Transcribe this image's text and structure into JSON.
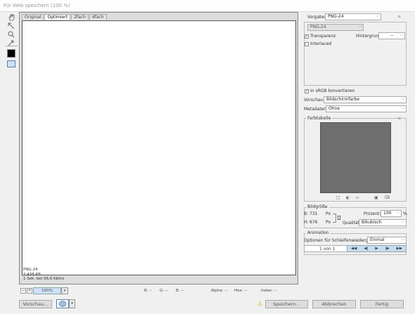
{
  "window": {
    "title": "Für Web speichern (100 %)"
  },
  "tools": [
    {
      "icon": "hand-icon"
    },
    {
      "icon": "slice-select-icon"
    },
    {
      "icon": "zoom-icon"
    },
    {
      "icon": "eyedropper-icon"
    }
  ],
  "tabs": [
    "Original",
    "Optimiert",
    "2fach",
    "4fach"
  ],
  "active_tab": "Optimiert",
  "canvas_info": {
    "format": "PNG-24",
    "size": "2,438 KB",
    "time": "1 Sek. bei 56,6 Kbit/s"
  },
  "status": {
    "zoom": "100%",
    "r": "R: --",
    "g": "G: --",
    "b": "B: --",
    "alpha": "Alpha: --",
    "hex": "Hex: --",
    "index": "Index: --"
  },
  "buttons": {
    "preview": "Vorschau...",
    "save": "Speichern...",
    "cancel": "Abbrechen",
    "done": "Fertig"
  },
  "panel": {
    "preset_label": "Vorgabe:",
    "preset_value": "PNG-24",
    "format_value": "PNG-24",
    "transparency": "Transparenz",
    "matte_label": "Hintergrund:",
    "matte_value": "--",
    "interlaced": "Interlaced",
    "srgb": "In sRGB konvertieren",
    "preview_label": "Vorschau:",
    "preview_value": "Bildschirmfarbe",
    "metadata_label": "Metadaten:",
    "metadata_value": "Ohne",
    "color_table": "Farbtabelle",
    "image_size": "Bildgröße",
    "width_label": "B:",
    "width_value": "731",
    "height_label": "H:",
    "height_value": "676",
    "px": "Px",
    "percent_label": "Prozent:",
    "percent_value": "100",
    "percent_unit": "%",
    "quality_label": "Qualität:",
    "quality_value": "Bikubisch",
    "animation": "Animation",
    "loop_label": "Optionen für Schleifenwiedergabe:",
    "loop_value": "Einmal",
    "frame_counter": "1 von 1"
  },
  "colors": {
    "accent": "#cfe0f7",
    "swatch": "#000000",
    "color_table": "#6e6e6e"
  }
}
